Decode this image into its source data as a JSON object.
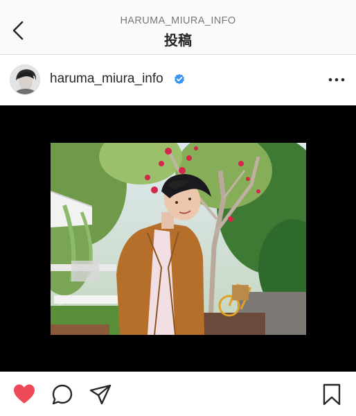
{
  "header": {
    "account_name": "HARUMA_MIURA_INFO",
    "title": "投稿",
    "back_icon": "chevron-left-icon"
  },
  "post": {
    "username": "haruma_miura_info",
    "verified": true,
    "verified_color": "#3897f0",
    "more_icon": "ellipsis-icon"
  },
  "actions": {
    "like_icon": "heart-filled-icon",
    "like_color": "#ed4956",
    "comment_icon": "comment-icon",
    "share_icon": "paper-plane-icon",
    "save_icon": "bookmark-icon"
  }
}
